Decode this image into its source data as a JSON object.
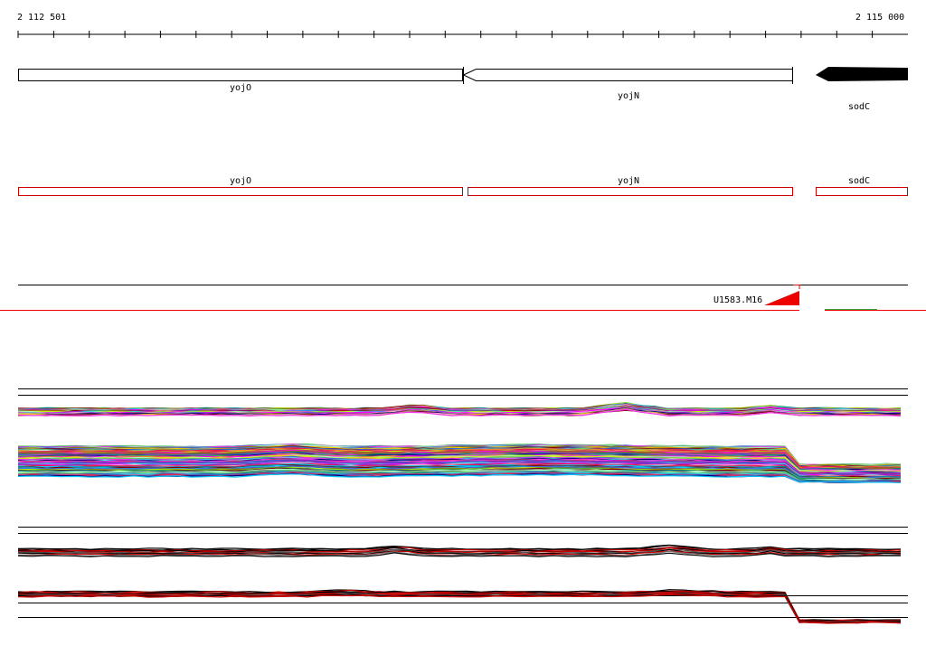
{
  "coordinates": {
    "start": "2 112 501",
    "end": "2 115 000"
  },
  "genes_track": [
    {
      "name": "yojO",
      "strand": "+"
    },
    {
      "name": "yojN",
      "strand": "-"
    },
    {
      "name": "sodC",
      "strand": "-"
    }
  ],
  "annotation_track": [
    {
      "name": "yojO"
    },
    {
      "name": "yojN"
    },
    {
      "name": "sodC"
    }
  ],
  "probe_label": "U1583.M16",
  "colors": {
    "feature_outline": "#000000",
    "annotation_outline": "#cc0000",
    "probe": "#ee0000",
    "probe_alt": "#33aa33"
  }
}
